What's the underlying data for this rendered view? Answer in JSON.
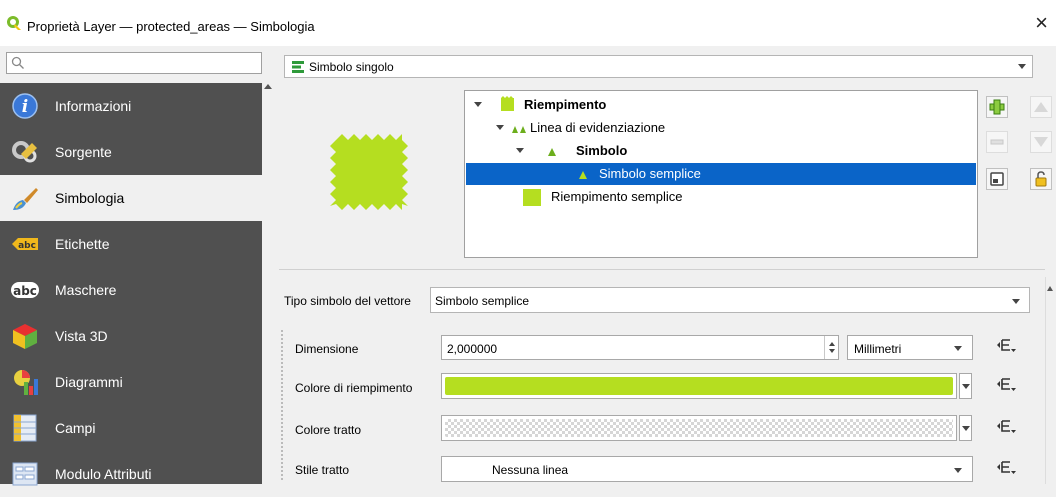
{
  "window": {
    "title": "Proprietà Layer — protected_areas — Simbologia",
    "close_glyph": "×"
  },
  "sidebar": {
    "search_placeholder": "",
    "items": [
      {
        "label": "Informazioni",
        "icon": "info-icon"
      },
      {
        "label": "Sorgente",
        "icon": "source-icon"
      },
      {
        "label": "Simbologia",
        "icon": "symbology-icon",
        "active": true
      },
      {
        "label": "Etichette",
        "icon": "labels-icon"
      },
      {
        "label": "Maschere",
        "icon": "masks-icon"
      },
      {
        "label": "Vista 3D",
        "icon": "view3d-icon"
      },
      {
        "label": "Diagrammi",
        "icon": "diagrams-icon"
      },
      {
        "label": "Campi",
        "icon": "fields-icon"
      },
      {
        "label": "Modulo Attributi",
        "icon": "attributes-form-icon"
      }
    ]
  },
  "renderer": {
    "selected": "Simbolo singolo"
  },
  "symbol_tree": {
    "rows": [
      {
        "label": "Riempimento",
        "bold": true
      },
      {
        "label": "Linea di evidenziazione",
        "bold": false
      },
      {
        "label": "Simbolo",
        "bold": true
      },
      {
        "label": "Simbolo semplice",
        "bold": false,
        "selected": true
      },
      {
        "label": "Riempimento semplice",
        "bold": false
      }
    ]
  },
  "symbol_layer": {
    "type_label": "Tipo simbolo del vettore",
    "type_value": "Simbolo semplice"
  },
  "properties": {
    "size_label": "Dimensione",
    "size_value": "2,000000",
    "unit_value": "Millimetri",
    "fill_color_label": "Colore di riempimento",
    "stroke_color_label": "Colore tratto",
    "stroke_style_label": "Stile tratto",
    "stroke_style_value": "Nessuna linea"
  },
  "colors": {
    "accent_selection": "#0a64c8",
    "fill_color": "#b5de20",
    "sidebar_bg": "#505050"
  }
}
